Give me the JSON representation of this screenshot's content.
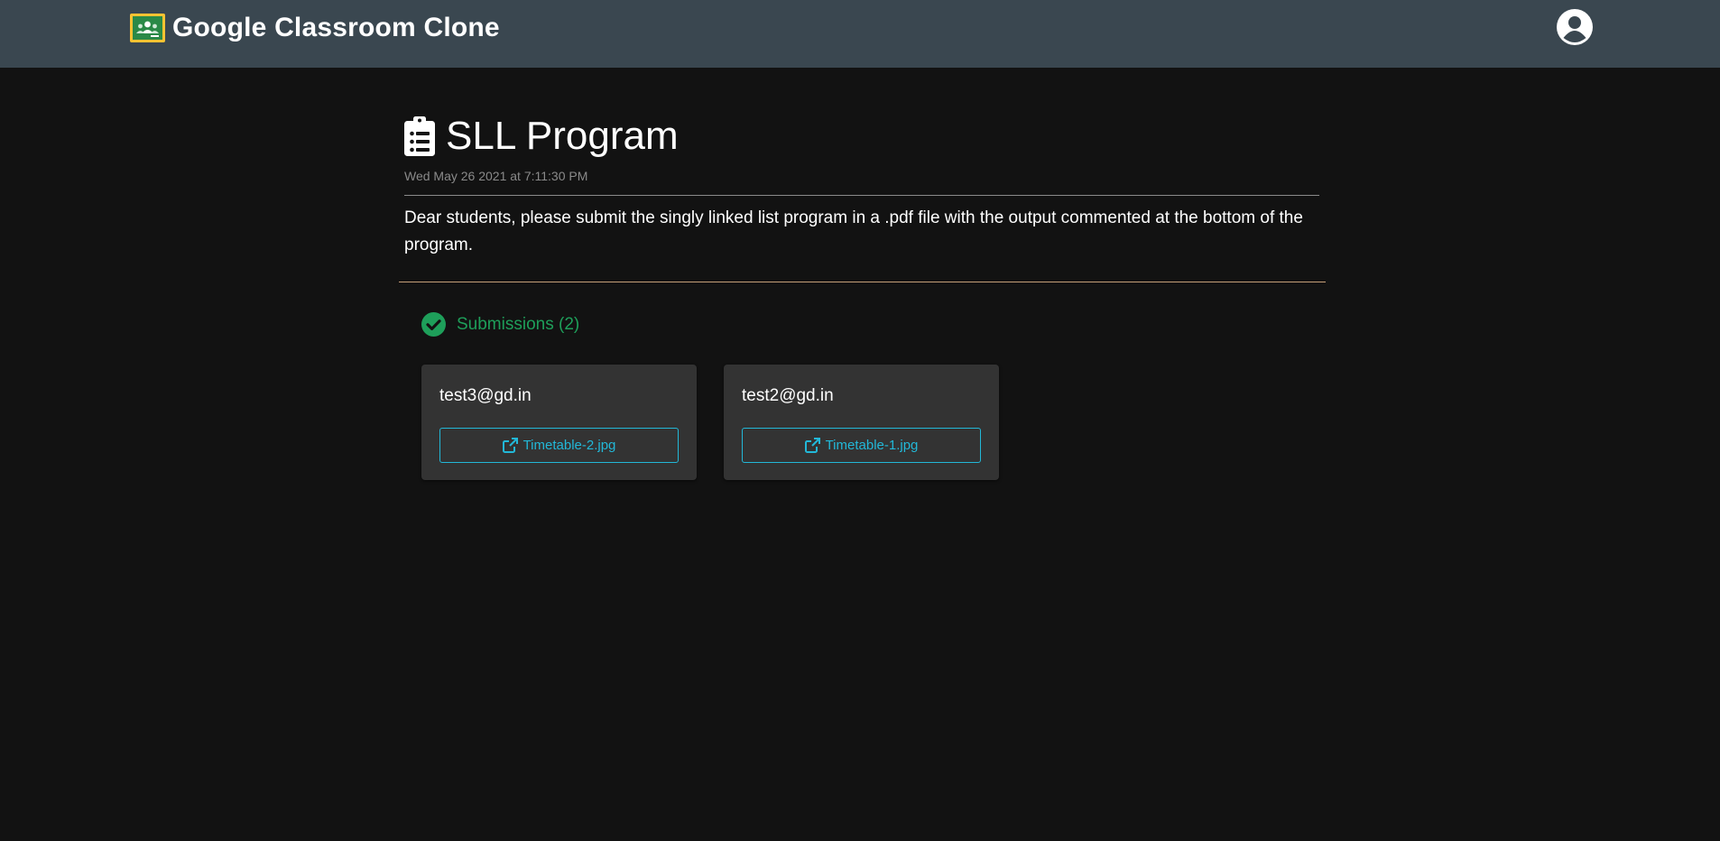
{
  "navbar": {
    "brand_title": "Google Classroom Clone",
    "logo_icon": "google-classroom-logo-icon",
    "account_icon": "account-circle-icon",
    "bg_color": "#3a4750"
  },
  "assignment": {
    "icon": "clipboard-list-icon",
    "title": "SLL Program",
    "timestamp": "Wed May 26 2021 at 7:11:30 PM",
    "description": "Dear students, please submit the singly linked list program in a .pdf file with the output commented at the bottom of the program."
  },
  "submissions": {
    "icon": "check-circle-icon",
    "label": "Submissions (2)",
    "accent_color": "#1e9f5a",
    "items": [
      {
        "email": "test3@gd.in",
        "file_icon": "external-link-icon",
        "file_name": "Timetable-2.jpg"
      },
      {
        "email": "test2@gd.in",
        "file_icon": "external-link-icon",
        "file_name": "Timetable-1.jpg"
      }
    ]
  },
  "colors": {
    "background": "#121212",
    "card": "#333333",
    "link": "#22b8d8",
    "divider_accent": "#c69e78"
  }
}
